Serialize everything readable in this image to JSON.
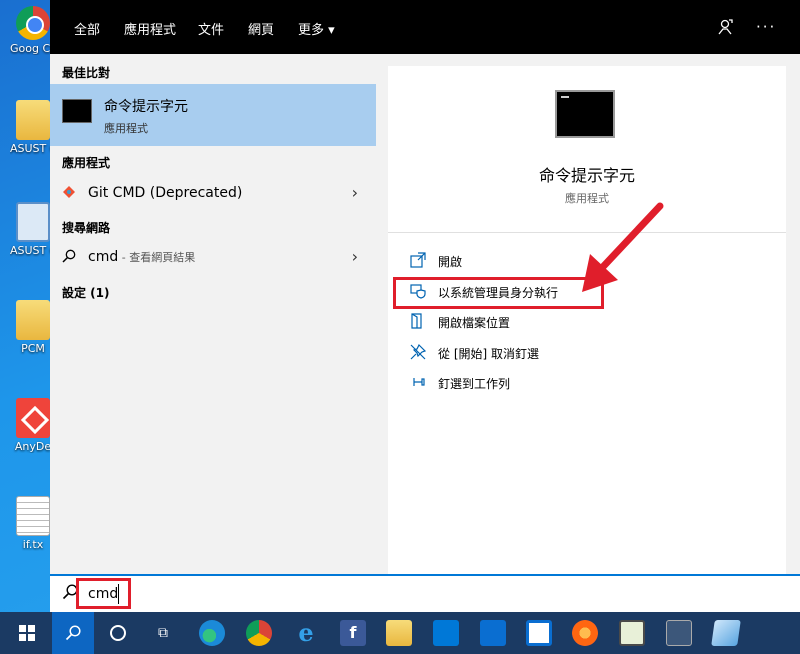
{
  "desktop": {
    "icons": [
      {
        "label": "Goog Chron",
        "kind": "chrome"
      },
      {
        "label": "ASUST Contro",
        "kind": "folder"
      },
      {
        "label": "ASUST Contro",
        "kind": "control"
      },
      {
        "label": "PCM",
        "kind": "folder"
      },
      {
        "label": "AnyDe",
        "kind": "anydesk"
      },
      {
        "label": "if.tx",
        "kind": "text-file"
      }
    ]
  },
  "search_panel": {
    "tabs": [
      "全部",
      "應用程式",
      "文件",
      "網頁",
      "更多 ▾"
    ],
    "active_tab": "全部",
    "top_icons": [
      "feedback-icon",
      "more-options-icon"
    ],
    "best_match": {
      "heading": "最佳比對",
      "title": "命令提示字元",
      "subtitle": "應用程式"
    },
    "apps": {
      "heading": "應用程式",
      "items": [
        {
          "label": "Git CMD (Deprecated)"
        }
      ]
    },
    "web": {
      "heading": "搜尋網路",
      "query": "cmd",
      "hint": " - 查看網頁結果"
    },
    "settings": {
      "heading": "設定 (1)"
    },
    "preview": {
      "title": "命令提示字元",
      "subtitle": "應用程式",
      "actions": [
        {
          "label": "開啟",
          "icon": "open-icon"
        },
        {
          "label": "以系統管理員身分執行",
          "icon": "shield-icon"
        },
        {
          "label": "開啟檔案位置",
          "icon": "folder-location-icon"
        },
        {
          "label": "從 [開始] 取消釘選",
          "icon": "unpin-icon"
        },
        {
          "label": "釘選到工作列",
          "icon": "pin-taskbar-icon"
        }
      ]
    }
  },
  "search_box": {
    "value": "cmd"
  },
  "annotations": {
    "highlight_color": "#e01e2b"
  },
  "taskbar": {
    "items": [
      "windows-logo",
      "search",
      "cortana",
      "task-view",
      "edge",
      "chrome",
      "internet-explorer",
      "facebook",
      "file-explorer",
      "store",
      "mail",
      "outlook",
      "firefox",
      "app",
      "command-prompt",
      "app"
    ]
  },
  "colors": {
    "accent": "#0078d7",
    "selected": "#a8cdef",
    "topbar": "#000000"
  }
}
